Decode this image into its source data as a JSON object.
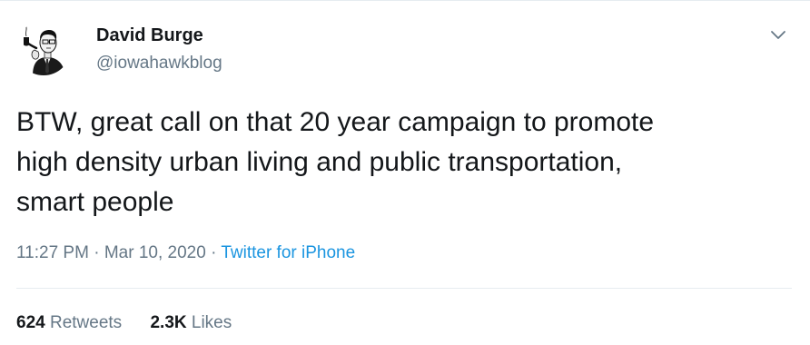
{
  "author": {
    "display_name": "David Burge",
    "handle": "@iowahawkblog",
    "avatar": "avatar-caricature-icon"
  },
  "menu_icon": "chevron-down-icon",
  "tweet": {
    "text": "BTW, great call on that 20 year campaign to promote\nhigh density urban living and public transportation,\nsmart people",
    "time": "11:27 PM",
    "separator": "·",
    "date": "Mar 10, 2020",
    "source": "Twitter for iPhone"
  },
  "stats": {
    "retweets_count": "624",
    "retweets_label": "Retweets",
    "likes_count": "2.3K",
    "likes_label": "Likes"
  },
  "colors": {
    "text_primary": "#14171a",
    "text_secondary": "#657786",
    "link": "#1b95e0",
    "divider": "#e6ecf0"
  }
}
